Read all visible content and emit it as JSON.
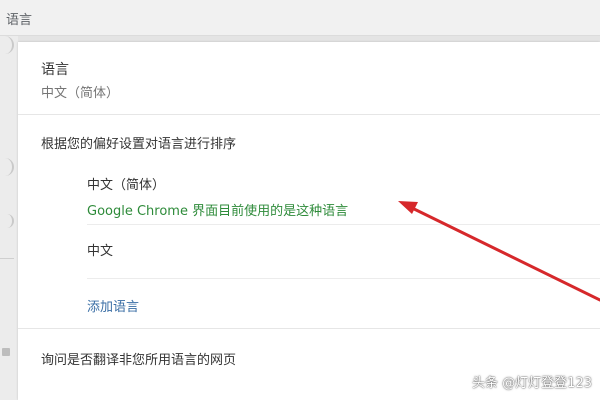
{
  "header": {
    "section_title": "语言"
  },
  "language_setting": {
    "label": "语言",
    "value": "中文（简体）"
  },
  "language_order": {
    "heading": "根据您的偏好设置对语言进行排序",
    "items": [
      {
        "name": "中文（简体）",
        "note": "Google Chrome 界面目前使用的是这种语言"
      },
      {
        "name": "中文"
      }
    ],
    "add_language_label": "添加语言"
  },
  "translate": {
    "label": "询问是否翻译非您所用语言的网页"
  },
  "annotation": {
    "arrow_color": "#d6282b"
  },
  "watermark": {
    "text": "头条 @灯灯登登123"
  },
  "colors": {
    "note_green": "#2e8b3a",
    "link_blue": "#3a6ea5"
  }
}
